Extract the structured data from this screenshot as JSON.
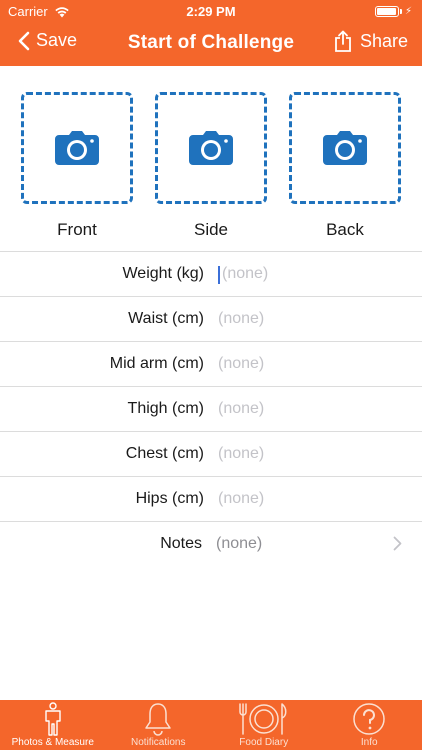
{
  "status_bar": {
    "carrier": "Carrier",
    "time": "2:29 PM",
    "battery_level": 0.95
  },
  "nav": {
    "back_label": "Save",
    "title": "Start of Challenge",
    "share_label": "Share"
  },
  "photos": [
    {
      "label": "Front"
    },
    {
      "label": "Side"
    },
    {
      "label": "Back"
    }
  ],
  "measurements": [
    {
      "label": "Weight (kg)",
      "value": "",
      "placeholder": "(none)",
      "focused": true
    },
    {
      "label": "Waist (cm)",
      "value": "",
      "placeholder": "(none)"
    },
    {
      "label": "Mid arm (cm)",
      "value": "",
      "placeholder": "(none)"
    },
    {
      "label": "Thigh (cm)",
      "value": "",
      "placeholder": "(none)"
    },
    {
      "label": "Chest (cm)",
      "value": "",
      "placeholder": "(none)"
    },
    {
      "label": "Hips (cm)",
      "value": "",
      "placeholder": "(none)"
    }
  ],
  "notes": {
    "label": "Notes",
    "value": "(none)"
  },
  "tabs": [
    {
      "label": "Photos & Measure",
      "icon": "person-icon",
      "active": true
    },
    {
      "label": "Notifications",
      "icon": "bell-icon"
    },
    {
      "label": "Food Diary",
      "icon": "plate-cutlery-icon"
    },
    {
      "label": "Info",
      "icon": "question-icon"
    }
  ],
  "colors": {
    "accent": "#f4662b",
    "photo_dash": "#1f72bd",
    "placeholder": "#c3c3c8"
  }
}
